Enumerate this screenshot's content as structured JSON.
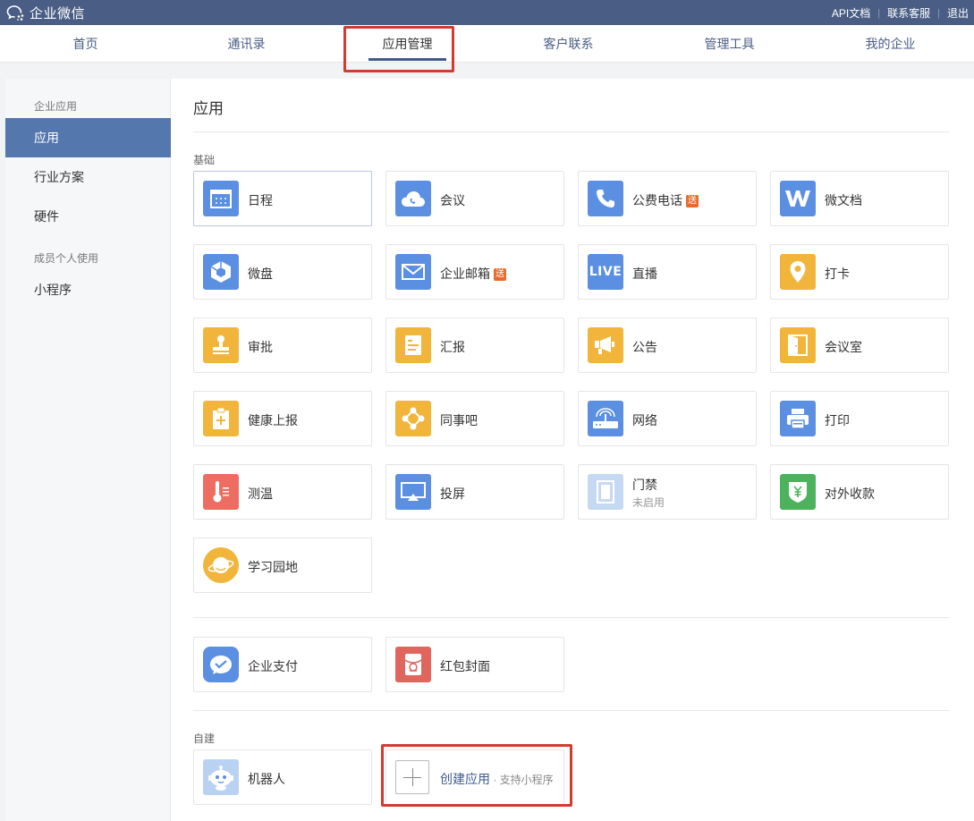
{
  "header": {
    "logo_text": "企业微信",
    "links": [
      "API文档",
      "联系客服",
      "退出"
    ]
  },
  "nav": {
    "items": [
      "首页",
      "通讯录",
      "应用管理",
      "客户联系",
      "管理工具",
      "我的企业"
    ],
    "active": "应用管理"
  },
  "sidebar": {
    "group1": "企业应用",
    "items1": [
      "应用",
      "行业方案",
      "硬件"
    ],
    "group2": "成员个人使用",
    "items2": [
      "小程序"
    ]
  },
  "main": {
    "title": "应用",
    "section_basic": "基础",
    "section_custom": "自建",
    "apps": [
      {
        "name": "日程",
        "icon": "calendar-icon",
        "color": "#5a8fe2"
      },
      {
        "name": "会议",
        "icon": "cloud-phone-icon",
        "color": "#5a8fe2"
      },
      {
        "name": "公费电话",
        "icon": "phone-icon",
        "color": "#5a8fe2",
        "badge": "送"
      },
      {
        "name": "微文档",
        "icon": "w-doc-icon",
        "color": "#5a8fe2"
      },
      {
        "name": "微盘",
        "icon": "disk-cube-icon",
        "color": "#5a8fe2"
      },
      {
        "name": "企业邮箱",
        "icon": "mail-icon",
        "color": "#5a8fe2",
        "badge": "送"
      },
      {
        "name": "直播",
        "icon": "live-icon",
        "color": "#5a8fe2",
        "icon_text": "LIVE"
      },
      {
        "name": "打卡",
        "icon": "location-pin-icon",
        "color": "#f2b53b"
      },
      {
        "name": "审批",
        "icon": "stamp-icon",
        "color": "#f2b53b"
      },
      {
        "name": "汇报",
        "icon": "report-icon",
        "color": "#f2b53b"
      },
      {
        "name": "公告",
        "icon": "megaphone-icon",
        "color": "#f2b53b"
      },
      {
        "name": "会议室",
        "icon": "door-icon",
        "color": "#f2b53b"
      },
      {
        "name": "健康上报",
        "icon": "health-clipboard-icon",
        "color": "#f2b53b"
      },
      {
        "name": "同事吧",
        "icon": "network-nodes-icon",
        "color": "#f2b53b"
      },
      {
        "name": "网络",
        "icon": "router-icon",
        "color": "#5a8fe2"
      },
      {
        "name": "打印",
        "icon": "printer-icon",
        "color": "#5a8fe2"
      },
      {
        "name": "测温",
        "icon": "thermometer-icon",
        "color": "#ee6d63"
      },
      {
        "name": "投屏",
        "icon": "screen-cast-icon",
        "color": "#5a8fe2"
      },
      {
        "name": "门禁",
        "icon": "access-door-icon",
        "color": "#c6d9f3",
        "sub": "未启用"
      },
      {
        "name": "对外收款",
        "icon": "yuan-shield-icon",
        "color": "#4bb35d"
      },
      {
        "name": "学习园地",
        "icon": "planet-icon",
        "color": "#f2b53b"
      }
    ],
    "extra_apps": [
      {
        "name": "企业支付",
        "icon": "pay-icon",
        "color": "#5a8fe2"
      },
      {
        "name": "红包封面",
        "icon": "red-envelope-icon",
        "color": "#e0655d"
      }
    ],
    "custom_apps": [
      {
        "name": "机器人",
        "icon": "robot-icon",
        "color": "#b9d2f2"
      }
    ],
    "create": {
      "label": "创建应用",
      "hint": " · 支持小程序"
    }
  }
}
